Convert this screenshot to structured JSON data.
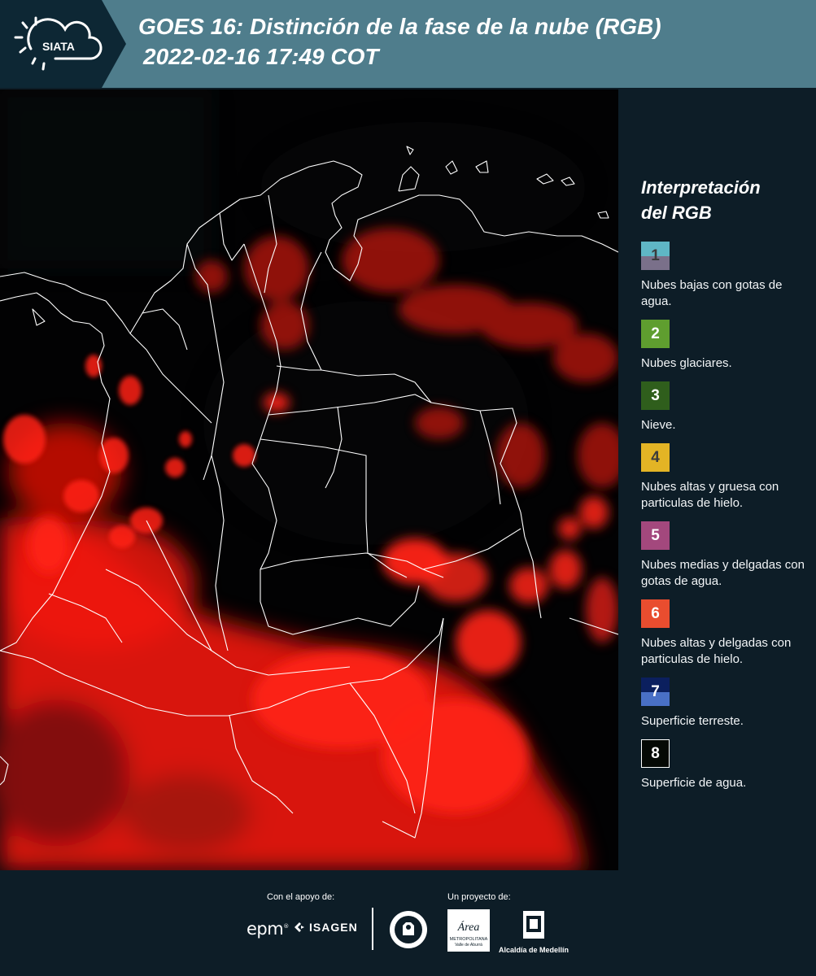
{
  "header": {
    "brand": "SIATA",
    "title_line1": "GOES 16: Distinción de la fase de la nube (RGB)",
    "title_line2": "2022-02-16 17:49 COT",
    "background_color": "#4f7d8c",
    "logo_background_color": "#0d2734"
  },
  "legend": {
    "title": "Interpretación\ndel RGB",
    "items": [
      {
        "number": "1",
        "description": "Nubes bajas con gotas de agua.",
        "color_top": "#5fb6c5",
        "color_bottom": "#7a708a",
        "number_color": "#3b3b3b"
      },
      {
        "number": "2",
        "description": "Nubes glaciares.",
        "color_top": "#5f9e2f",
        "color_bottom": "#5f9e2f",
        "number_color": "#ffffff"
      },
      {
        "number": "3",
        "description": "Nieve.",
        "color_top": "#2f5e1c",
        "color_bottom": "#2f5e1c",
        "number_color": "#ffffff"
      },
      {
        "number": "4",
        "description": "Nubes altas y gruesa con particulas de hielo.",
        "color_top": "#e3b425",
        "color_bottom": "#e3b425",
        "number_color": "#3b3b3b"
      },
      {
        "number": "5",
        "description": "Nubes medias y delgadas con gotas de agua.",
        "color_top": "#a3487d",
        "color_bottom": "#a3487d",
        "number_color": "#ffffff"
      },
      {
        "number": "6",
        "description": "Nubes altas y delgadas con particulas de hielo.",
        "color_top": "#e94d2f",
        "color_bottom": "#e94d2f",
        "number_color": "#ffffff"
      },
      {
        "number": "7",
        "description": "Superficie terreste.",
        "color_top": "#0b1f5e",
        "color_bottom": "#4970c6",
        "number_color": "#ffffff"
      },
      {
        "number": "8",
        "description": "Superficie de agua.",
        "color_top": "#050905",
        "color_bottom": "#050905",
        "number_color": "#ffffff",
        "border": "#ffffff"
      }
    ]
  },
  "footer": {
    "support_label": "Con el apoyo de:",
    "project_label": "Un proyecto de:",
    "sponsor_logos": [
      "epm",
      "ISAGEN"
    ],
    "partner_logos": [
      "seal-logo",
      "area-metropolitana-logo",
      "escudo-medellin-logo"
    ],
    "area_text": "Área",
    "area_subtext": "METROPOLITANA",
    "area_subtext2": "Valle de Aburrá",
    "medellin_text": "Alcaldía de Medellín"
  },
  "map": {
    "background_color": "#020203",
    "cloud_color": "#ff1a10",
    "border_color": "#ffffff"
  }
}
